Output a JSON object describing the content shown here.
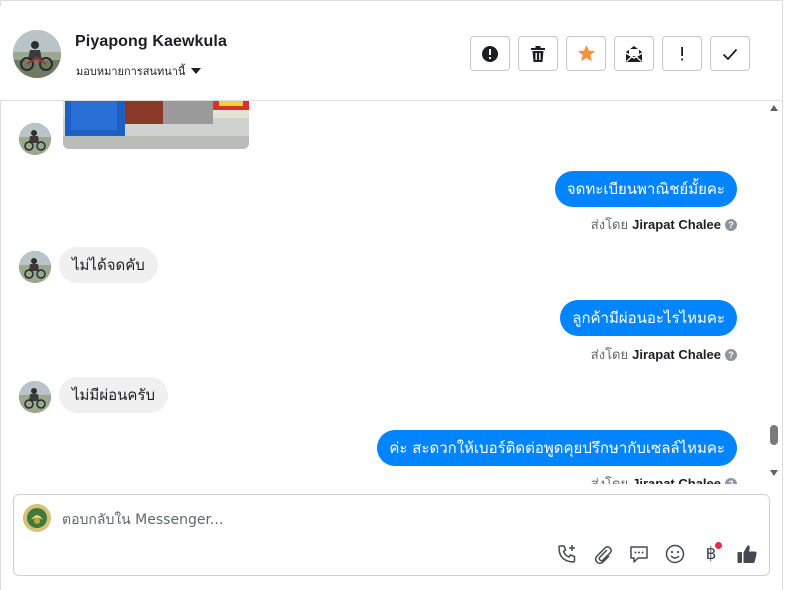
{
  "header": {
    "contact_name": "Piyapong Kaewkula",
    "assign_label": "มอบหมายการสนทนานี้",
    "actions": [
      {
        "name": "mark-spam",
        "icon": "alert-circle-icon"
      },
      {
        "name": "delete",
        "icon": "trash-icon"
      },
      {
        "name": "star",
        "icon": "star-icon"
      },
      {
        "name": "mark-unread",
        "icon": "envelope-open-icon"
      },
      {
        "name": "follow-up",
        "icon": "exclamation-icon"
      },
      {
        "name": "mark-done",
        "icon": "check-icon"
      }
    ],
    "star_color": "#f7923b"
  },
  "conversation": {
    "messages": [
      {
        "direction": "in",
        "type": "photo"
      },
      {
        "direction": "out",
        "text": "จดทะเบียนพาณิชย์มั้ยคะ",
        "sent_by_prefix": "ส่งโดย",
        "agent": "Jirapat Chalee"
      },
      {
        "direction": "in",
        "text": "ไม่ได้จดคับ"
      },
      {
        "direction": "out",
        "text": "ลูกค้ามีผ่อนอะไรไหมคะ",
        "sent_by_prefix": "ส่งโดย",
        "agent": "Jirapat Chalee"
      },
      {
        "direction": "in",
        "text": "ไม่มีผ่อนครับ"
      },
      {
        "direction": "out",
        "text": "ค่ะ สะดวกให้เบอร์ติดต่อพูดคุยปรึกษากับเซลล์ไหมคะ",
        "sent_by_prefix": "ส่งโดย",
        "agent": "Jirapat Chalee"
      }
    ],
    "outgoing_bubble_color": "#0084ff",
    "incoming_bubble_color": "#f0f0f0"
  },
  "composer": {
    "placeholder": "ตอบกลับใน Messenger...",
    "tools": [
      "phone-plus-icon",
      "paperclip-icon",
      "chat-bubble-icon",
      "smiley-icon",
      "baht-icon",
      "thumbs-up-icon"
    ],
    "baht_symbol": "฿"
  }
}
